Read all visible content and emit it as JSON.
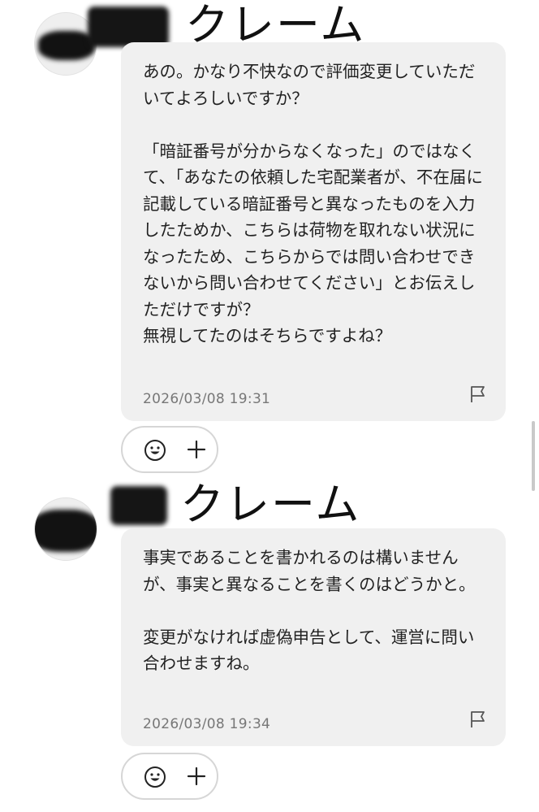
{
  "messages": [
    {
      "sender_label": "クレーム",
      "text": "あの。かなり不快なので評価変更していただいてよろしいですか？\n\n「暗証番号が分からなくなった」のではなくて、「あなたの依頼した宅配業者が、不在届に記載している暗証番号と異なったものを入力したためか、こちらは荷物を取れない状況になったため、こちらからでは問い合わせできないから問い合わせてください」とお伝えしただけですが？\n無視してたのはそちらですよね？",
      "timestamp": "2026/03/08 19:31",
      "icons": {
        "report": "flag-icon",
        "reaction": "smiley-icon",
        "add": "plus-icon"
      }
    },
    {
      "sender_label": "クレーム",
      "text": "事実であることを書かれるのは構いませんが、事実と異なることを書くのはどうかと。\n\n変更がなければ虚偽申告として、運営に問い合わせますね。",
      "timestamp": "2026/03/08 19:34",
      "icons": {
        "report": "flag-icon",
        "reaction": "smiley-icon",
        "add": "plus-icon"
      }
    }
  ],
  "colors": {
    "bubble_background": "#f0f0f0",
    "timestamp": "#777777",
    "text": "#222222"
  }
}
